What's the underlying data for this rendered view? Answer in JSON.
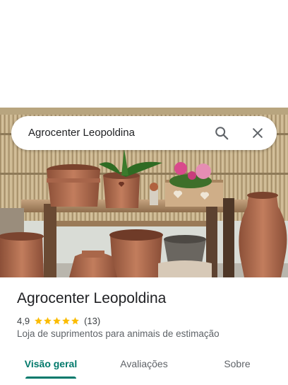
{
  "search": {
    "query": "Agrocenter Leopoldina",
    "search_icon": "search-icon",
    "close_icon": "close-icon"
  },
  "place": {
    "name": "Agrocenter Leopoldina",
    "rating": "4,9",
    "stars": 5,
    "review_count": "(13)",
    "category": "Loja de suprimentos para animais de estimação"
  },
  "tabs": [
    {
      "label": "Visão geral",
      "active": true
    },
    {
      "label": "Avaliações",
      "active": false
    },
    {
      "label": "Sobre",
      "active": false
    }
  ],
  "colors": {
    "accent": "#00796b",
    "star": "#fbbc04",
    "text_primary": "#202124",
    "text_secondary": "#5f6368"
  }
}
